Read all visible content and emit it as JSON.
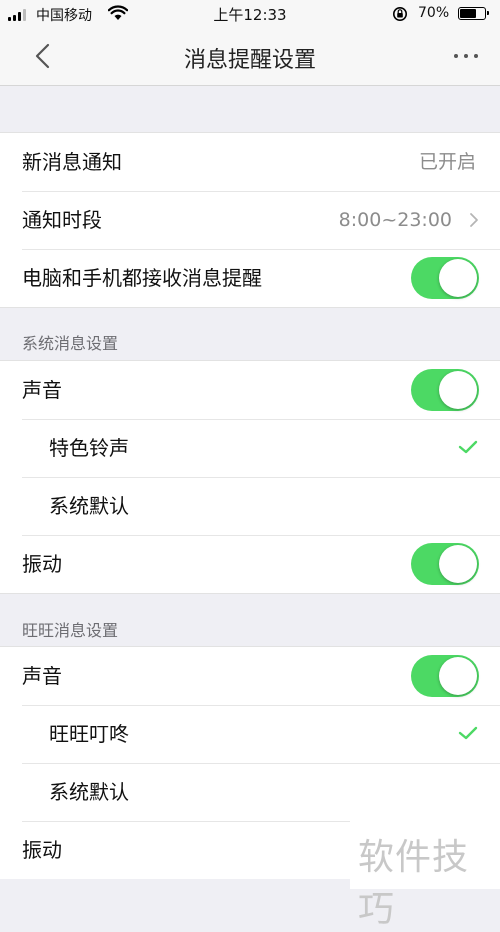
{
  "status_bar": {
    "carrier": "中国移动",
    "time": "上午12:33",
    "battery": "70%",
    "battery_level": 0.7
  },
  "nav": {
    "title": "消息提醒设置"
  },
  "general": {
    "new_message_label": "新消息通知",
    "new_message_value": "已开启",
    "period_label": "通知时段",
    "period_value": "8:00~23:00",
    "pc_mobile_label": "电脑和手机都接收消息提醒",
    "pc_mobile_on": true
  },
  "system": {
    "header": "系统消息设置",
    "sound_label": "声音",
    "sound_on": true,
    "ringtone_special": "特色铃声",
    "ringtone_default": "系统默认",
    "selected_ringtone": "特色铃声",
    "vibrate_label": "振动",
    "vibrate_on": true
  },
  "wangwang": {
    "header": "旺旺消息设置",
    "sound_label": "声音",
    "sound_on": true,
    "ringtone_special": "旺旺叮咚",
    "ringtone_default": "系统默认",
    "selected_ringtone": "旺旺叮咚",
    "vibrate_label": "振动"
  },
  "watermark": "软件技巧",
  "colors": {
    "toggle_on": "#4cd964",
    "check": "#4cd964",
    "background": "#efeff4"
  }
}
